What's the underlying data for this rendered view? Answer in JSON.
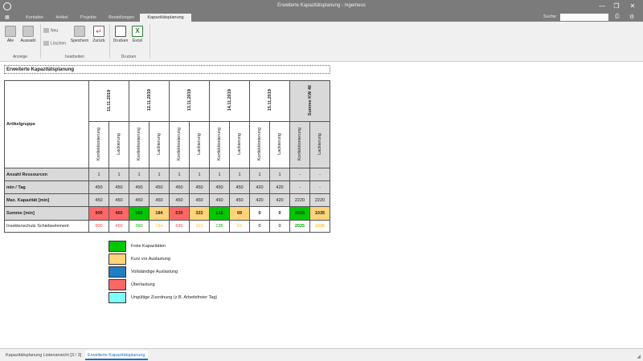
{
  "window": {
    "title": "Erweiterte Kapazitätsplanung - mgemeus",
    "minimize": "—",
    "maximize": "❐",
    "close": "✕"
  },
  "nav": {
    "tabs": [
      "Kontakte",
      "Artikel",
      "Projekte",
      "Bestellungen",
      "Kapazitätsplanung"
    ],
    "active_tab": "Kapazitätsplanung",
    "search_label": "Suche:",
    "search_value": ""
  },
  "ribbon": {
    "alle": "Alle",
    "auswahl": "Auswahl",
    "anzeige": "Anzeige",
    "neu": "Neu",
    "loeschen": "Löschen",
    "speichern": "Speichern",
    "zurueck": "Zurück",
    "bearbeiten": "bearbeiten",
    "drucken_btn": "Drucken",
    "excel": "Excel",
    "drucken_group": "Drucken"
  },
  "report": {
    "title": "Erweiterte Kapazitätsplanung",
    "artikelgruppe": "Artikelgruppe",
    "dates": [
      "11.11.2019",
      "12.11.2019",
      "13.11.2019",
      "14.11.2019",
      "15.11.2019"
    ],
    "summe_head": "Summe KW 46",
    "sub_k": "Konfektionierung",
    "sub_l": "Lackierung",
    "rows": [
      {
        "label": "Anzahl Ressourcen",
        "values": [
          "1",
          "1",
          "1",
          "1",
          "1",
          "1",
          "1",
          "1",
          "1",
          "1",
          "-",
          "-"
        ]
      },
      {
        "label": "min / Tag",
        "values": [
          "450",
          "450",
          "450",
          "450",
          "450",
          "450",
          "450",
          "450",
          "420",
          "420",
          "-",
          "-"
        ]
      },
      {
        "label": "Max. Kapazität [min]",
        "values": [
          "450",
          "450",
          "450",
          "450",
          "450",
          "450",
          "450",
          "450",
          "420",
          "420",
          "2220",
          "2220"
        ]
      },
      {
        "label": "Summe [min]",
        "values": [
          "900",
          "460",
          "360",
          "184",
          "630",
          "322",
          "135",
          "69",
          "0",
          "0",
          "2025",
          "1035"
        ]
      },
      {
        "label": "Insektenschutz Schiebeelement",
        "values": [
          "900",
          "460",
          "360",
          "184",
          "630",
          "322",
          "135",
          "69",
          "0",
          "0",
          "2025",
          "1035"
        ]
      }
    ],
    "legend": [
      {
        "label": "Freie Kapazitäten",
        "color": "#00c800"
      },
      {
        "label": "Kurz vor Auslastung",
        "color": "#ffd47a"
      },
      {
        "label": "Vollständige Auslastung",
        "color": "#1f7fc4"
      },
      {
        "label": "Überlastung",
        "color": "#ff6666"
      },
      {
        "label": "Ungültige Zuordnung (z.B. Arbeitsfreier Tag)",
        "color": "#80ffff"
      }
    ]
  },
  "bottom_tabs": [
    "Kapazitätsplanung Listenansicht [3 / 3]",
    "Erweiterte Kapazitätsplanung"
  ],
  "bottom_active": "Erweiterte Kapazitätsplanung"
}
